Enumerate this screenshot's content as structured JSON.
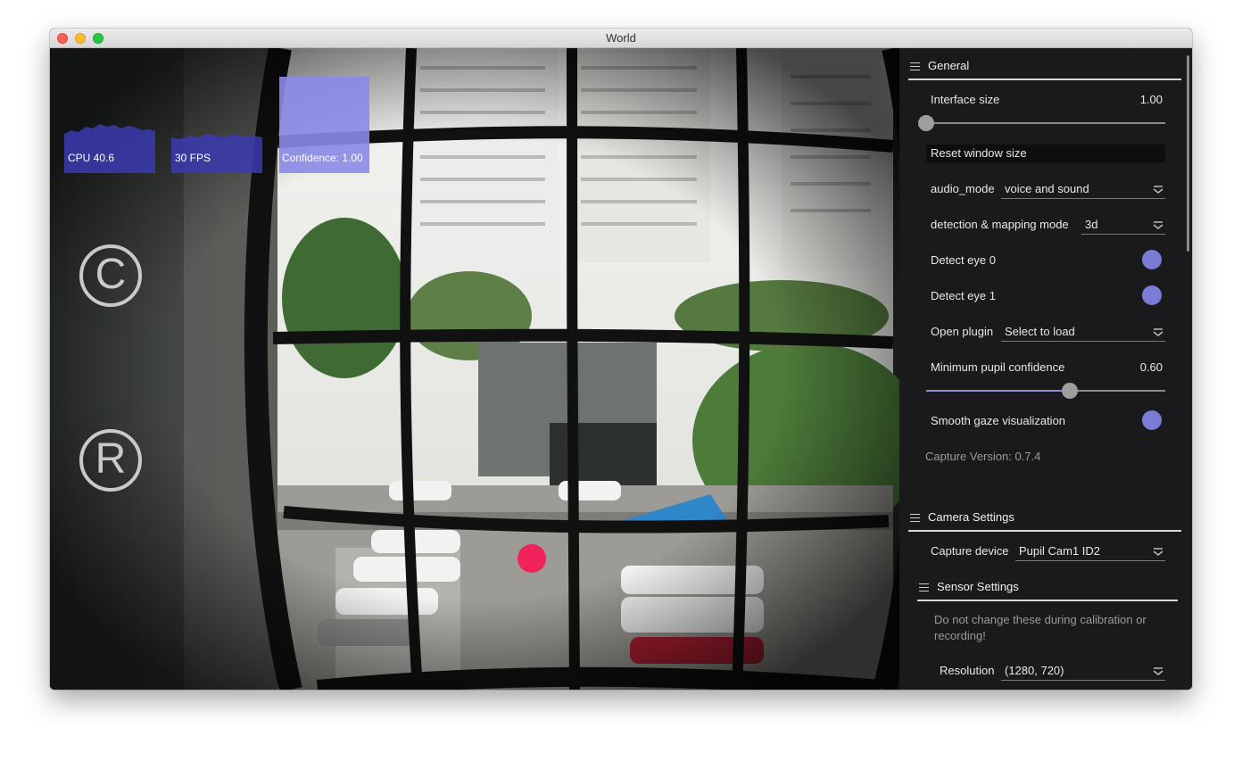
{
  "window": {
    "title": "World"
  },
  "overlay": {
    "graphs": [
      {
        "label": "CPU 40.6"
      },
      {
        "label": "30 FPS"
      },
      {
        "label": "Confidence: 1.00"
      }
    ],
    "icons": [
      {
        "name": "capture-c-icon",
        "glyph": "C"
      },
      {
        "name": "record-r-icon",
        "glyph": "R"
      }
    ],
    "accent_color": "#7b7bd8",
    "gaze_color": "#f0245a"
  },
  "general": {
    "title": "General",
    "interface_size": {
      "label": "Interface size",
      "value": "1.00",
      "fraction": 0.0
    },
    "reset_button": "Reset window size",
    "audio_mode": {
      "label": "audio_mode",
      "value": "voice and sound"
    },
    "detection_mode": {
      "label": "detection & mapping mode",
      "value": "3d"
    },
    "detect_eye0": {
      "label": "Detect eye 0",
      "on": true
    },
    "detect_eye1": {
      "label": "Detect eye 1",
      "on": true
    },
    "open_plugin": {
      "label": "Open plugin",
      "value": "Select to load"
    },
    "min_pupil_conf": {
      "label": "Minimum pupil confidence",
      "value": "0.60",
      "fraction": 0.6
    },
    "smooth_gaze": {
      "label": "Smooth gaze visualization",
      "on": true
    },
    "capture_version": "Capture Version: 0.7.4"
  },
  "camera": {
    "title": "Camera Settings",
    "capture_device": {
      "label": "Capture device",
      "value": "Pupil Cam1 ID2"
    },
    "sensor": {
      "title": "Sensor Settings",
      "warning": "Do not change these during calibration or recording!",
      "resolution": {
        "label": "Resolution",
        "value": "(1280, 720)"
      }
    }
  }
}
